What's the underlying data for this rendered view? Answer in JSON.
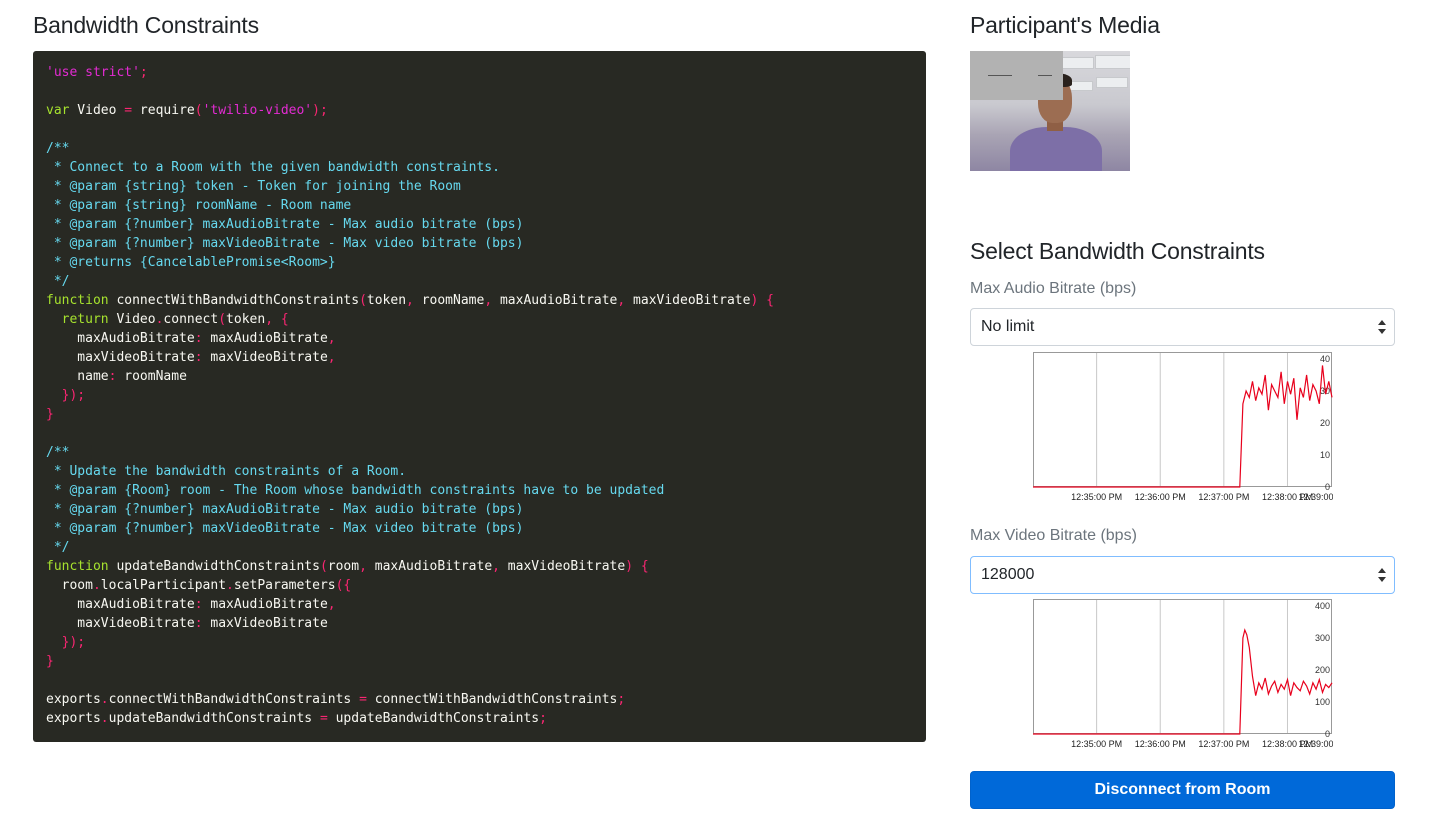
{
  "headings": {
    "bandwidth_constraints": "Bandwidth Constraints",
    "participants_media": "Participant's Media",
    "select_bandwidth_constraints": "Select Bandwidth Constraints"
  },
  "code": {
    "language": "javascript",
    "lines": [
      [
        [
          "str",
          "'use strict'"
        ],
        [
          "op",
          ";"
        ]
      ],
      [],
      [
        [
          "kw",
          "var"
        ],
        [
          "pl",
          " Video "
        ],
        [
          "op",
          "="
        ],
        [
          "pl",
          " require"
        ],
        [
          "op",
          "("
        ],
        [
          "str",
          "'twilio-video'"
        ],
        [
          "op",
          ");"
        ]
      ],
      [],
      [
        [
          "cm",
          "/**"
        ]
      ],
      [
        [
          "cm",
          " * Connect to a Room with the given bandwidth constraints."
        ]
      ],
      [
        [
          "cm",
          " * @param {string} token - Token for joining the Room"
        ]
      ],
      [
        [
          "cm",
          " * @param {string} roomName - Room name"
        ]
      ],
      [
        [
          "cm",
          " * @param {?number} maxAudioBitrate - Max audio bitrate (bps)"
        ]
      ],
      [
        [
          "cm",
          " * @param {?number} maxVideoBitrate - Max video bitrate (bps)"
        ]
      ],
      [
        [
          "cm",
          " * @returns {CancelablePromise<Room>}"
        ]
      ],
      [
        [
          "cm",
          " */"
        ]
      ],
      [
        [
          "kw",
          "function"
        ],
        [
          "pl",
          " connectWithBandwidthConstraints"
        ],
        [
          "op",
          "("
        ],
        [
          "pl",
          "token"
        ],
        [
          "op",
          ","
        ],
        [
          "pl",
          " roomName"
        ],
        [
          "op",
          ","
        ],
        [
          "pl",
          " maxAudioBitrate"
        ],
        [
          "op",
          ","
        ],
        [
          "pl",
          " maxVideoBitrate"
        ],
        [
          "op",
          ") {"
        ]
      ],
      [
        [
          "pl",
          "  "
        ],
        [
          "kw",
          "return"
        ],
        [
          "pl",
          " Video"
        ],
        [
          "op",
          "."
        ],
        [
          "pl",
          "connect"
        ],
        [
          "op",
          "("
        ],
        [
          "pl",
          "token"
        ],
        [
          "op",
          ", {"
        ]
      ],
      [
        [
          "pl",
          "    maxAudioBitrate"
        ],
        [
          "op",
          ":"
        ],
        [
          "pl",
          " maxAudioBitrate"
        ],
        [
          "op",
          ","
        ]
      ],
      [
        [
          "pl",
          "    maxVideoBitrate"
        ],
        [
          "op",
          ":"
        ],
        [
          "pl",
          " maxVideoBitrate"
        ],
        [
          "op",
          ","
        ]
      ],
      [
        [
          "pl",
          "    name"
        ],
        [
          "op",
          ":"
        ],
        [
          "pl",
          " roomName"
        ]
      ],
      [
        [
          "op",
          "  });"
        ]
      ],
      [
        [
          "op",
          "}"
        ]
      ],
      [],
      [
        [
          "cm",
          "/**"
        ]
      ],
      [
        [
          "cm",
          " * Update the bandwidth constraints of a Room."
        ]
      ],
      [
        [
          "cm",
          " * @param {Room} room - The Room whose bandwidth constraints have to be updated"
        ]
      ],
      [
        [
          "cm",
          " * @param {?number} maxAudioBitrate - Max audio bitrate (bps)"
        ]
      ],
      [
        [
          "cm",
          " * @param {?number} maxVideoBitrate - Max video bitrate (bps)"
        ]
      ],
      [
        [
          "cm",
          " */"
        ]
      ],
      [
        [
          "kw",
          "function"
        ],
        [
          "pl",
          " updateBandwidthConstraints"
        ],
        [
          "op",
          "("
        ],
        [
          "pl",
          "room"
        ],
        [
          "op",
          ","
        ],
        [
          "pl",
          " maxAudioBitrate"
        ],
        [
          "op",
          ","
        ],
        [
          "pl",
          " maxVideoBitrate"
        ],
        [
          "op",
          ") {"
        ]
      ],
      [
        [
          "pl",
          "  room"
        ],
        [
          "op",
          "."
        ],
        [
          "pl",
          "localParticipant"
        ],
        [
          "op",
          "."
        ],
        [
          "pl",
          "setParameters"
        ],
        [
          "op",
          "({"
        ]
      ],
      [
        [
          "pl",
          "    maxAudioBitrate"
        ],
        [
          "op",
          ":"
        ],
        [
          "pl",
          " maxAudioBitrate"
        ],
        [
          "op",
          ","
        ]
      ],
      [
        [
          "pl",
          "    maxVideoBitrate"
        ],
        [
          "op",
          ":"
        ],
        [
          "pl",
          " maxVideoBitrate"
        ]
      ],
      [
        [
          "op",
          "  });"
        ]
      ],
      [
        [
          "op",
          "}"
        ]
      ],
      [],
      [
        [
          "pl",
          "exports"
        ],
        [
          "op",
          "."
        ],
        [
          "pl",
          "connectWithBandwidthConstraints "
        ],
        [
          "op",
          "="
        ],
        [
          "pl",
          " connectWithBandwidthConstraints"
        ],
        [
          "op",
          ";"
        ]
      ],
      [
        [
          "pl",
          "exports"
        ],
        [
          "op",
          "."
        ],
        [
          "pl",
          "updateBandwidthConstraints "
        ],
        [
          "op",
          "="
        ],
        [
          "pl",
          " updateBandwidthConstraints"
        ],
        [
          "op",
          ";"
        ]
      ]
    ]
  },
  "audio": {
    "label": "Max Audio Bitrate (bps)",
    "selected": "No limit"
  },
  "video": {
    "label": "Max Video Bitrate (bps)",
    "selected": "128000"
  },
  "disconnect_label": "Disconnect from Room",
  "colors": {
    "code_bg": "#282923",
    "string": "#e42bd3",
    "comment": "#66d9ef",
    "keyword": "#a6e22e",
    "operator": "#f92672",
    "plain": "#f8f8f2",
    "button_bg": "#0069d9",
    "series": "#e8001c"
  },
  "chart_data": [
    {
      "type": "line",
      "title": "",
      "x_tick_labels": [
        "12:35:00 PM",
        "12:36:00 PM",
        "12:37:00 PM",
        "12:38:00 PM",
        "12:39:00"
      ],
      "y_tick_labels": [
        "0",
        "10",
        "20",
        "30",
        "40"
      ],
      "ylim": [
        0,
        40
      ],
      "grid": "vertical",
      "series": [
        {
          "color": "#e8001c",
          "x_minutes": [
            0,
            3.2,
            3.25,
            3.3,
            3.35,
            3.4,
            3.45,
            3.5,
            3.55,
            3.6,
            3.65,
            3.7,
            3.75,
            3.8,
            3.85,
            3.9,
            3.95,
            4.0,
            4.05,
            4.1,
            4.15,
            4.2,
            4.25,
            4.3,
            4.35,
            4.4,
            4.45,
            4.5,
            4.55,
            4.6,
            4.65,
            4.7
          ],
          "values": [
            0,
            0,
            0,
            26,
            30,
            28,
            33,
            27,
            31,
            29,
            35,
            24,
            32,
            30,
            28,
            36,
            26,
            33,
            29,
            34,
            21,
            31,
            28,
            35,
            27,
            32,
            30,
            26,
            38,
            29,
            33,
            28
          ]
        }
      ]
    },
    {
      "type": "line",
      "title": "",
      "x_tick_labels": [
        "12:35:00 PM",
        "12:36:00 PM",
        "12:37:00 PM",
        "12:38:00 PM",
        "12:39:00"
      ],
      "y_tick_labels": [
        "0",
        "100",
        "200",
        "300",
        "400"
      ],
      "ylim": [
        0,
        400
      ],
      "grid": "vertical",
      "series": [
        {
          "color": "#e8001c",
          "x_minutes": [
            0,
            3.2,
            3.25,
            3.3,
            3.33,
            3.36,
            3.4,
            3.45,
            3.5,
            3.55,
            3.6,
            3.65,
            3.7,
            3.75,
            3.8,
            3.85,
            3.9,
            3.95,
            4.0,
            4.05,
            4.1,
            4.15,
            4.2,
            4.25,
            4.3,
            4.35,
            4.4,
            4.45,
            4.5,
            4.55,
            4.6,
            4.65,
            4.7
          ],
          "values": [
            0,
            0,
            0,
            300,
            325,
            310,
            270,
            180,
            120,
            160,
            140,
            175,
            125,
            150,
            165,
            130,
            155,
            140,
            170,
            120,
            160,
            145,
            135,
            165,
            150,
            125,
            160,
            140,
            170,
            130,
            155,
            145,
            160
          ]
        }
      ]
    }
  ]
}
